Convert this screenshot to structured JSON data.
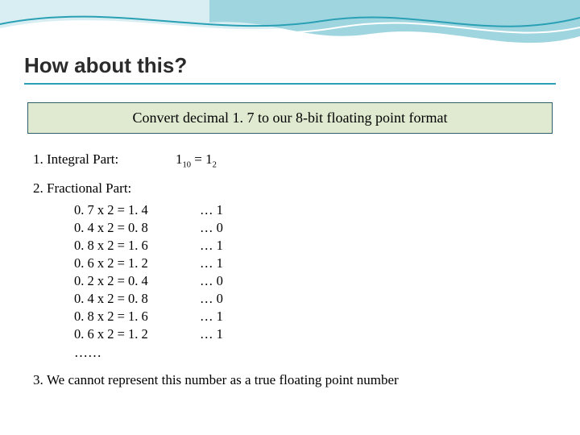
{
  "title": "How about this?",
  "box": "Convert decimal 1. 7 to our 8-bit floating point format",
  "item1": {
    "label": "Integral Part:",
    "eq_a": "1",
    "eq_sub_a": "10",
    "eq_mid": " = ",
    "eq_b": "1",
    "eq_sub_b": "2"
  },
  "item2": {
    "label": "Fractional Part:",
    "rows": [
      {
        "calc": "0. 7 x 2  = 1. 4",
        "bit": "… 1"
      },
      {
        "calc": "0. 4 x 2 = 0. 8",
        "bit": "… 0"
      },
      {
        "calc": "0. 8 x 2 = 1. 6",
        "bit": "… 1"
      },
      {
        "calc": "0. 6 x 2 = 1. 2",
        "bit": " … 1"
      },
      {
        "calc": "0. 2 x 2 = 0. 4",
        "bit": " … 0"
      },
      {
        "calc": "0. 4 x 2 = 0. 8",
        "bit": " … 0"
      },
      {
        "calc": "0. 8 x 2 = 1. 6",
        "bit": " … 1"
      },
      {
        "calc": "0. 6 x 2 = 1. 2",
        "bit": " … 1"
      }
    ],
    "ellipsis": "……"
  },
  "item3": "We cannot represent this number as a true floating point number"
}
